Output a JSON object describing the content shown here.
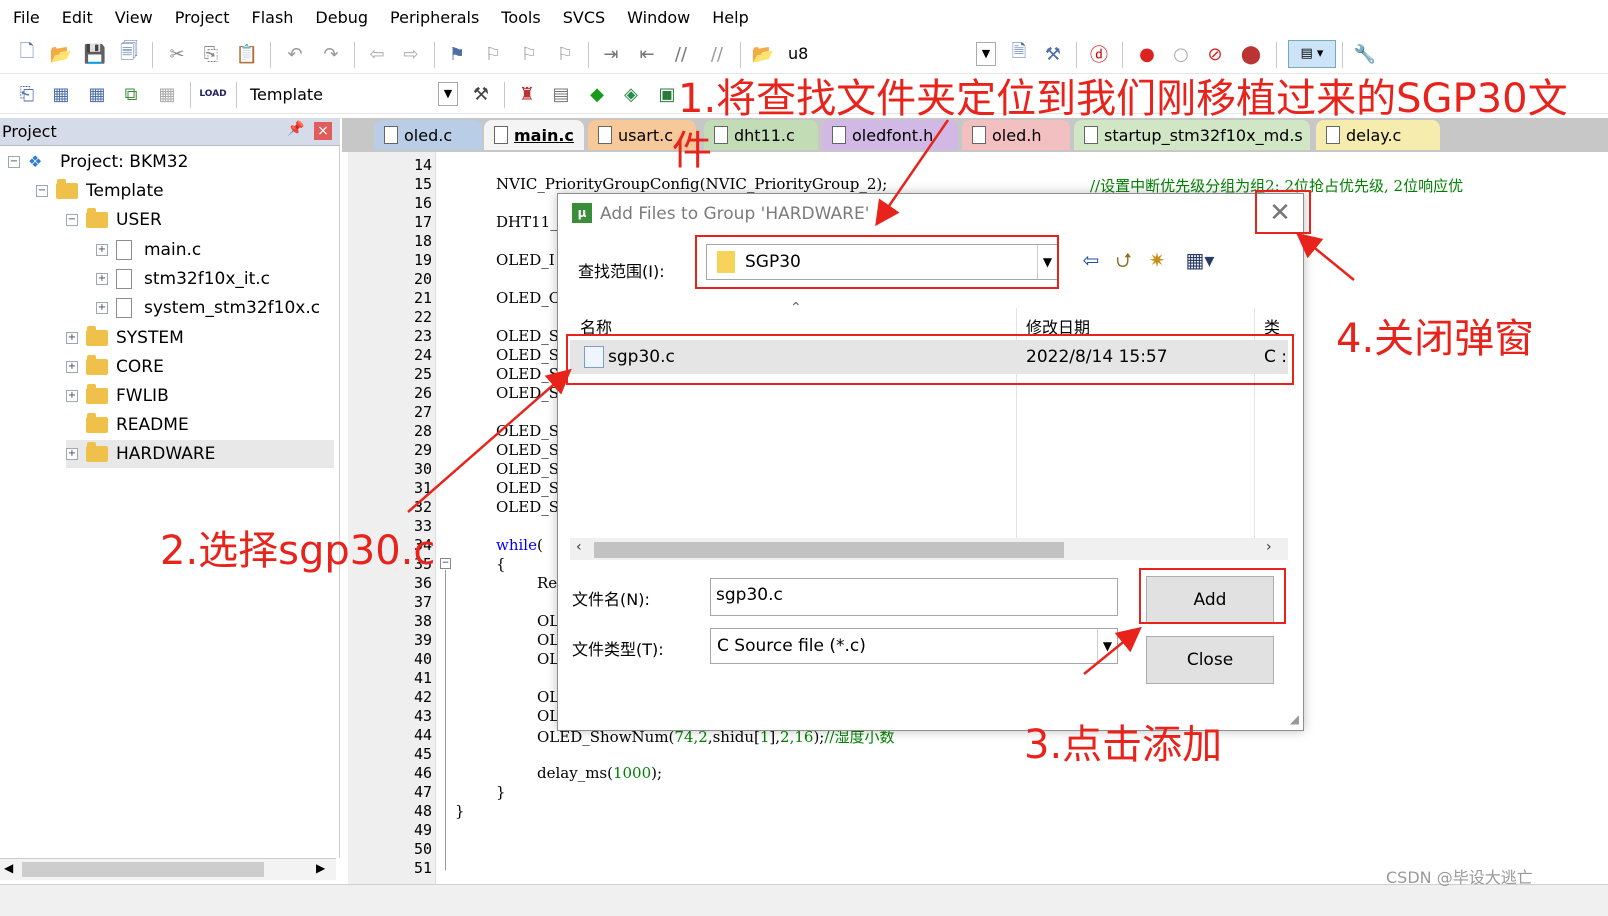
{
  "menu": [
    "File",
    "Edit",
    "View",
    "Project",
    "Flash",
    "Debug",
    "Peripherals",
    "Tools",
    "SVCS",
    "Window",
    "Help"
  ],
  "toolbar": {
    "find_text": "u8",
    "target_name": "Template",
    "load_label": "LOAD"
  },
  "project_panel": {
    "title": "Project",
    "tree": [
      {
        "label": "Project: BKM32",
        "type": "project"
      },
      {
        "label": "Template",
        "type": "target"
      },
      {
        "label": "USER",
        "type": "folder"
      },
      {
        "label": "main.c",
        "type": "file"
      },
      {
        "label": "stm32f10x_it.c",
        "type": "file"
      },
      {
        "label": "system_stm32f10x.c",
        "type": "file"
      },
      {
        "label": "SYSTEM",
        "type": "folder"
      },
      {
        "label": "CORE",
        "type": "folder"
      },
      {
        "label": "FWLIB",
        "type": "folder"
      },
      {
        "label": "README",
        "type": "folder"
      },
      {
        "label": "HARDWARE",
        "type": "folder",
        "selected": true
      }
    ]
  },
  "tabs": [
    "oled.c",
    "main.c",
    "usart.c",
    "dht11.c",
    "oledfont.h",
    "oled.h",
    "startup_stm32f10x_md.s",
    "delay.c"
  ],
  "active_tab": "main.c",
  "editor": {
    "line_numbers": [
      "14",
      "15",
      "16",
      "17",
      "18",
      "19",
      "20",
      "21",
      "22",
      "23",
      "24",
      "25",
      "26",
      "27",
      "28",
      "29",
      "30",
      "31",
      "32",
      "33",
      "34",
      "35",
      "36",
      "37",
      "38",
      "39",
      "40",
      "41",
      "42",
      "43",
      "44",
      "45",
      "46",
      "47",
      "48",
      "49",
      "50",
      "51"
    ],
    "lines": {
      "l15": "NVIC_PriorityGroupConfig(NVIC_PriorityGroup_2);",
      "l15_comment": "//设置中断优先级分组为组2: 2位抢占优先级, 2位响应优",
      "l17": "DHT11_",
      "l19": "OLED_I",
      "l21": "OLED_C",
      "l23": "OLED_S",
      "l24": "OLED_S",
      "l25": "OLED_S",
      "l26": "OLED_S",
      "l28": "OLED_S",
      "l29": "OLED_S",
      "l30": "OLED_S",
      "l31": "OLED_S",
      "l32": "OLED_S",
      "l34_kw": "while",
      "l34": "(",
      "l35": "{",
      "l36": "Re",
      "l38": "OLI",
      "l39": "OLI",
      "l40": "OLI",
      "l42": "OLI",
      "l43": "OLI",
      "l44_a": "OLED_ShowNum(",
      "l44_nums": "74,2",
      "l44_b": ",shidu[",
      "l44_n1": "1",
      "l44_c": "],",
      "l44_n2": "2,16",
      "l44_d": ");",
      "l44_comment": "//湿度小数",
      "l46_a": "delay_ms(",
      "l46_num": "1000",
      "l46_b": ");",
      "l47": "}",
      "l48": "}"
    }
  },
  "dialog": {
    "title": "Add Files to Group 'HARDWARE'",
    "look_in_label": "查找范围(I):",
    "look_in_value": "SGP30",
    "columns": [
      "名称",
      "修改日期",
      "类"
    ],
    "files": [
      {
        "name": "sgp30.c",
        "date": "2022/8/14 15:57",
        "type": "C :"
      }
    ],
    "filename_label": "文件名(N):",
    "filename_value": "sgp30.c",
    "filetype_label": "文件类型(T):",
    "filetype_value": "C Source file (*.c)",
    "add_label": "Add",
    "close_label": "Close"
  },
  "annotations": {
    "step1": "1.将查找文件夹定位到我们刚移植过来的SGP30文",
    "step1_cont": "件",
    "step2": "2.选择sgp30.c",
    "step3": "3.点击添加",
    "step4": "4.关闭弹窗",
    "color": "#e8231b"
  },
  "watermark": "CSDN @毕设大逃亡"
}
